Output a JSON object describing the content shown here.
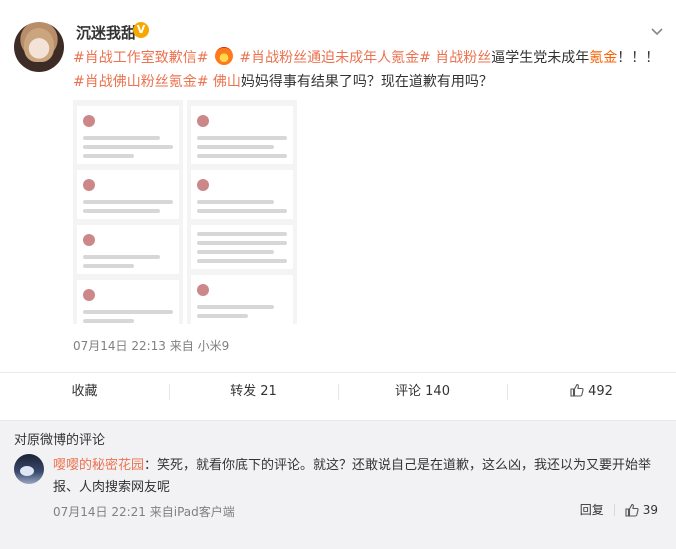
{
  "post": {
    "username": "沉迷我甜",
    "verified_badge": "V",
    "content": {
      "tag1": "#肖战工作室致歉信#",
      "emoji": "fire-emoji",
      "tag2": "#肖战粉丝通迫未成年人氪金#",
      "tag3": "肖战粉丝",
      "text1": "逼学生党未成年",
      "highlight1": "氪金",
      "text2": "！！！",
      "tag4": "#肖战佛山粉丝氪金#",
      "tag5": "佛山",
      "text3": "妈妈得事有结果了吗？现在道歉有用吗？"
    },
    "meta": "07月14日 22:13  来自 小米9"
  },
  "actions": {
    "favorite": "收藏",
    "repost": "转发 21",
    "comment": "评论 140",
    "like_count": "492"
  },
  "comments": {
    "title": "对原微博的评论",
    "items": [
      {
        "user": "嘤嘤的秘密花园",
        "text": "：笑死，就看你底下的评论。就这？还敢说自己是在道歉，这么凶，我还以为又要开始举报、人肉搜索网友呢",
        "meta": "07月14日 22:21  来自iPad客户端",
        "reply_label": "回复",
        "like_count": "39"
      }
    ]
  },
  "colors": {
    "link": "#eb7350",
    "highlight": "#f86000",
    "badge": "#f7a800"
  }
}
